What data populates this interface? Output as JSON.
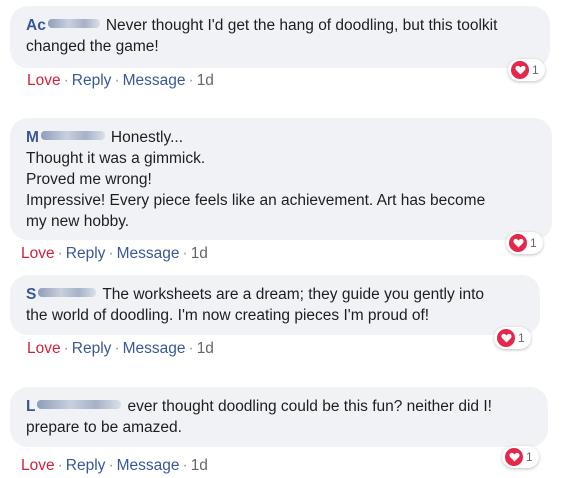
{
  "comments": [
    {
      "author_initial": "Ac",
      "lines": [
        "Never thought I'd get the hang of doodling, but this toolkit",
        "changed the game!"
      ],
      "actions": {
        "love": "Love",
        "reply": "Reply",
        "message": "Message",
        "time": "1d"
      },
      "reaction_count": "1"
    },
    {
      "author_initial": "M",
      "lines": [
        "Honestly...",
        "Thought it was a gimmick.",
        "Proved me wrong!",
        "Impressive! Every piece feels like an achievement. Art has become",
        "my new hobby."
      ],
      "actions": {
        "love": "Love",
        "reply": "Reply",
        "message": "Message",
        "time": "1d"
      },
      "reaction_count": "1"
    },
    {
      "author_initial": "S",
      "lines": [
        "The worksheets are a dream; they guide you gently into",
        "the world of doodling. I'm now creating pieces I'm proud of!"
      ],
      "actions": {
        "love": "Love",
        "reply": "Reply",
        "message": "Message",
        "time": "1d"
      },
      "reaction_count": "1"
    },
    {
      "author_initial": "L",
      "lines": [
        "ever thought doodling could be this fun? neither did I!",
        "prepare to be amazed."
      ],
      "actions": {
        "love": "Love",
        "reply": "Reply",
        "message": "Message",
        "time": "1d"
      },
      "reaction_count": "1"
    }
  ],
  "colors": {
    "author": "#385898",
    "love": "#d0233a",
    "bubble": "#f0f2f5",
    "heart": "#e4274b"
  }
}
